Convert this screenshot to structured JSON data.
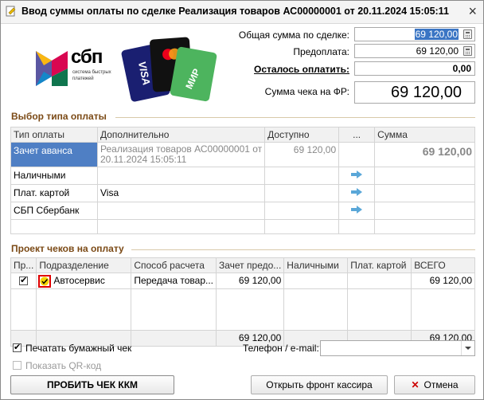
{
  "window": {
    "title": "Ввод суммы оплаты по сделке Реализация товаров АС00000001 от 20.11.2024 15:05:11",
    "close_glyph": "×"
  },
  "logos": {
    "sbp_text": "сбп",
    "sbp_sub1": "система быстрых",
    "sbp_sub2": "платежей",
    "visa": "VISA",
    "mir": "МИР"
  },
  "summary": {
    "total_label": "Общая сумма по сделке:",
    "total_value": "69 120,00",
    "prepay_label": "Предоплата:",
    "prepay_value": "69 120,00",
    "remaining_label": "Осталось оплатить:",
    "remaining_value": "0,00",
    "receipt_label": "Сумма чека на ФР:",
    "receipt_value": "69 120,00"
  },
  "payment_types": {
    "section_title": "Выбор типа оплаты",
    "columns": [
      "Тип оплаты",
      "Дополнительно",
      "Доступно",
      "...",
      "Сумма"
    ],
    "rows": [
      {
        "type": "Зачет аванса",
        "extra1": "Реализация товаров АС00000001 от",
        "extra2": "20.11.2024 15:05:11",
        "available": "69 120,00",
        "sum": "69 120,00"
      },
      {
        "type": "Наличными",
        "extra1": "",
        "available": "",
        "sum": ""
      },
      {
        "type": "Плат. картой",
        "extra1": "Visa",
        "available": "",
        "sum": ""
      },
      {
        "type": "СБП Сбербанк",
        "extra1": "",
        "available": "",
        "sum": ""
      }
    ]
  },
  "receipts": {
    "section_title": "Проект чеков на оплату",
    "columns": [
      "Пр...",
      "Подразделение",
      "Способ расчета",
      "Зачет предо...",
      "Наличными",
      "Плат. картой",
      "ВСЕГО"
    ],
    "rows": [
      {
        "checked": true,
        "division": "Автосервис",
        "method": "Передача товар...",
        "offset": "69 120,00",
        "cash": "",
        "card": "",
        "total": "69 120,00"
      }
    ],
    "footer": {
      "offset": "69 120,00",
      "total": "69 120,00"
    }
  },
  "options": {
    "print_paper": "Печатать бумажный чек",
    "print_paper_checked": true,
    "show_qr": "Показать QR-код",
    "show_qr_checked": false,
    "phone_label": "Телефон / e-mail:",
    "phone_value": ""
  },
  "buttons": {
    "punch": "ПРОБИТЬ ЧЕК ККМ",
    "front": "Открыть фронт кассира",
    "cancel": "Отмена"
  },
  "colors": {
    "section": "#7b4a16",
    "selected_row": "#4f7fc4",
    "highlight_box": "#e00000",
    "visa_blue": "#1a1f71",
    "sbp_accent": "#5b57a2"
  }
}
